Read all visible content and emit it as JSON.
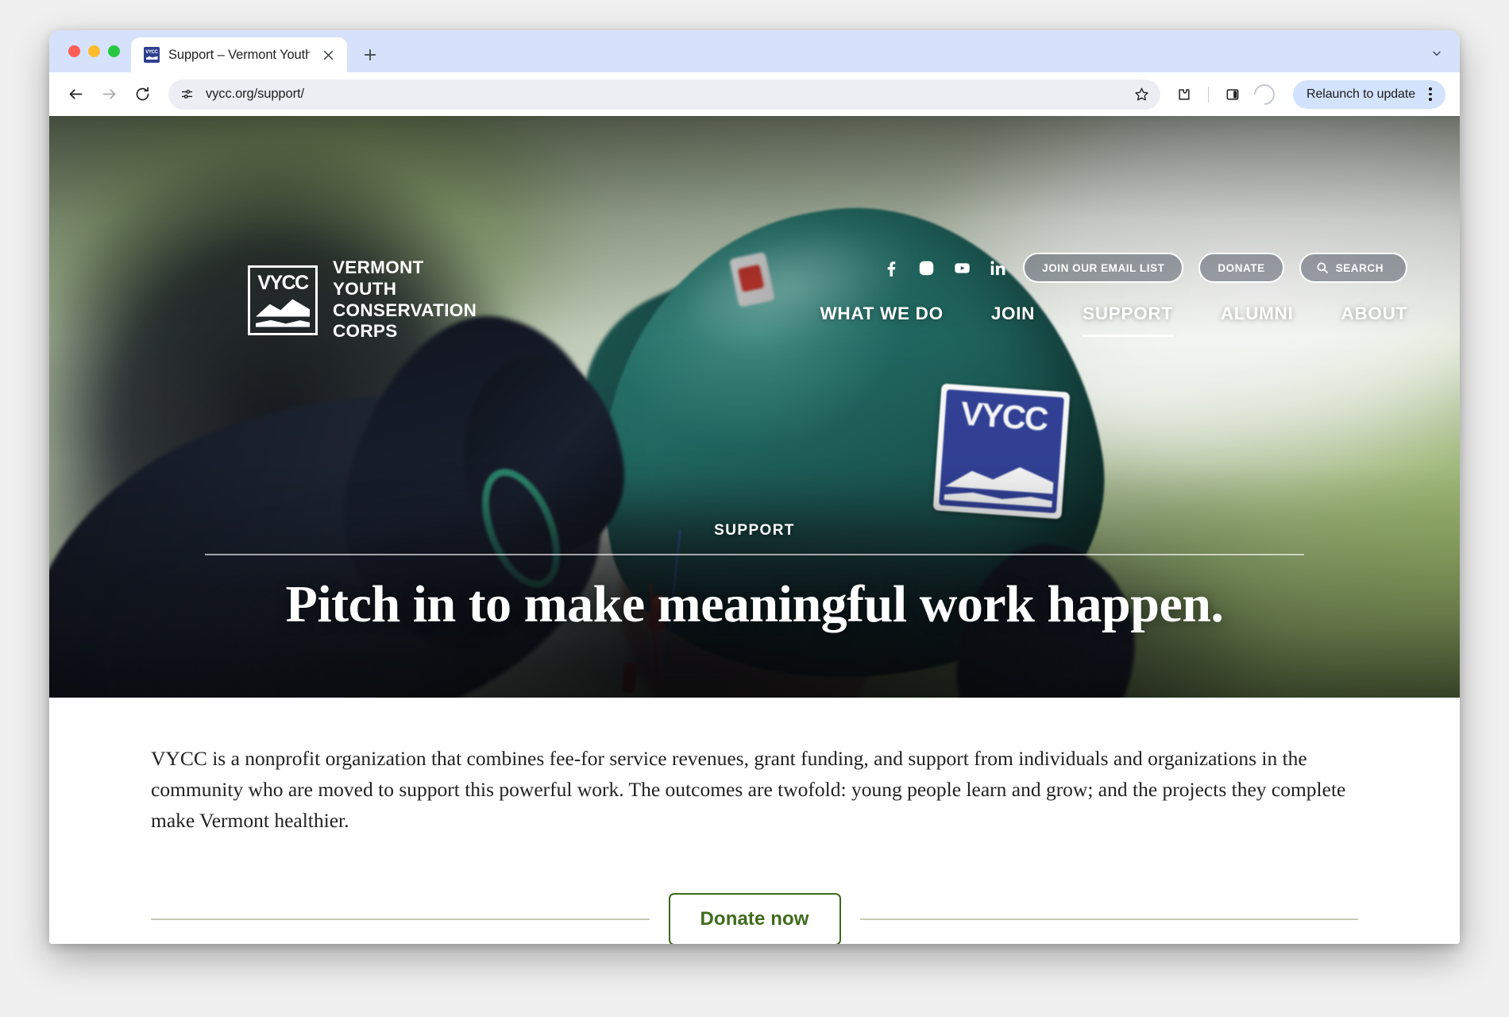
{
  "browser": {
    "tab": {
      "title": "Support – Vermont Youth Con",
      "favicon_label": "VYCC"
    },
    "new_tab_label": "+",
    "url": "vycc.org/support/",
    "relaunch_label": "Relaunch to update",
    "icons": {
      "back": "back-arrow-icon",
      "forward": "forward-arrow-icon",
      "reload": "reload-icon",
      "site_info": "site-settings-icon",
      "bookmark": "star-icon",
      "extensions": "extensions-puzzle-icon",
      "side_panel": "side-panel-icon",
      "profile": "profile-avatar-icon",
      "menu": "kebab-menu-icon",
      "tab_close": "close-icon",
      "tab_list": "chevron-down-icon"
    }
  },
  "site": {
    "logo": {
      "mark_text": "VYCC",
      "name_line1": "VERMONT",
      "name_line2": "YOUTH",
      "name_line3": "CONSERVATION",
      "name_line4": "CORPS"
    },
    "social": [
      {
        "name": "facebook-icon",
        "label": "Facebook"
      },
      {
        "name": "instagram-icon",
        "label": "Instagram"
      },
      {
        "name": "youtube-icon",
        "label": "YouTube"
      },
      {
        "name": "linkedin-icon",
        "label": "LinkedIn"
      }
    ],
    "utility_buttons": {
      "email_list": "JOIN OUR EMAIL LIST",
      "donate": "DONATE",
      "search": "SEARCH"
    },
    "nav": [
      {
        "label": "WHAT WE DO",
        "active": false
      },
      {
        "label": "JOIN",
        "active": false
      },
      {
        "label": "SUPPORT",
        "active": true
      },
      {
        "label": "ALUMNI",
        "active": false
      },
      {
        "label": "ABOUT",
        "active": false
      }
    ]
  },
  "hero": {
    "eyebrow": "SUPPORT",
    "title": "Pitch in to make meaningful work happen.",
    "helmet_patch_text": "VYCC"
  },
  "main": {
    "paragraph": "VYCC is a nonprofit organization that combines fee-for service revenues, grant funding, and support from individuals and organizations in the community who are moved to support this powerful work. The outcomes are twofold: young people learn and grow; and the projects they complete make Vermont healthier.",
    "donate_button": "Donate now"
  },
  "colors": {
    "brand_blue": "#33439a",
    "donate_green": "#3f6b1d",
    "rule_sage": "#c4cbb2",
    "tab_strip": "#d6e2fb",
    "relaunch_pill": "#d3e3fd"
  }
}
